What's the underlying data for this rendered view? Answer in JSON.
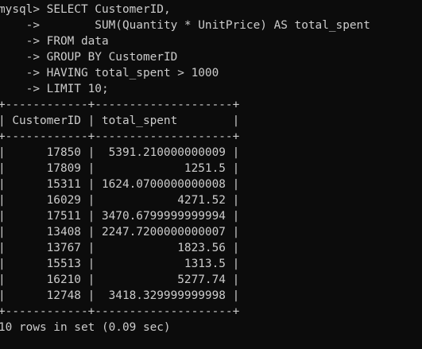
{
  "terminal": {
    "background": "#0c0c0c",
    "foreground": "#cccccc",
    "prompt": "mysql>",
    "continuation": "    ->",
    "query_lines": [
      "SELECT CustomerID,",
      "       SUM(Quantity * UnitPrice) AS total_spent",
      "FROM data",
      "GROUP BY CustomerID",
      "HAVING total_spent > 1000",
      "LIMIT 10;"
    ],
    "table": {
      "border_line": "+------------+--------------------+",
      "columns": [
        "CustomerID",
        "total_spent"
      ],
      "rows": [
        [
          "17850",
          "5391.210000000009"
        ],
        [
          "17809",
          "1251.5"
        ],
        [
          "15311",
          "1624.0700000000008"
        ],
        [
          "16029",
          "4271.52"
        ],
        [
          "17511",
          "3470.6799999999994"
        ],
        [
          "13408",
          "2247.7200000000007"
        ],
        [
          "13767",
          "1823.56"
        ],
        [
          "15513",
          "1313.5"
        ],
        [
          "16210",
          "5277.74"
        ],
        [
          "12748",
          "3418.329999999998"
        ]
      ]
    },
    "status": "10 rows in set (0.09 sec)"
  }
}
